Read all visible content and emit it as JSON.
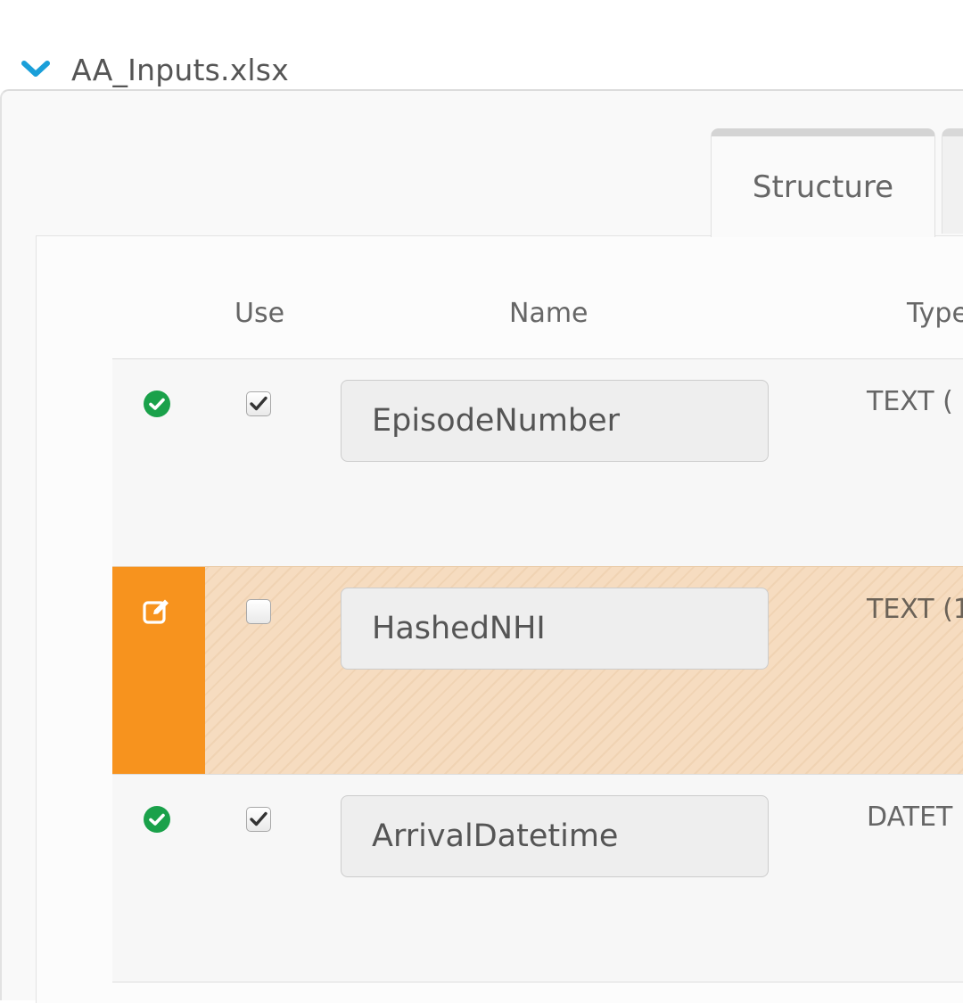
{
  "file": {
    "name": "AA_Inputs.xlsx",
    "expand_icon": "chevron-down-icon",
    "accent_color": "#1a9fd9"
  },
  "tabs": [
    {
      "label": "Structure",
      "active": true
    }
  ],
  "table": {
    "headers": {
      "use": "Use",
      "name": "Name",
      "type": "Type"
    },
    "rows": [
      {
        "status": "ok",
        "status_icon": "check-circle-icon",
        "use": true,
        "name": "EpisodeNumber",
        "type": "TEXT ("
      },
      {
        "status": "changed",
        "status_icon": "edit-icon",
        "use": false,
        "name": "HashedNHI",
        "type": "TEXT (1"
      },
      {
        "status": "ok",
        "status_icon": "check-circle-icon",
        "use": true,
        "name": "ArrivalDatetime",
        "type": "DATET"
      }
    ]
  },
  "colors": {
    "ok": "#1aa14a",
    "changed": "#f7931e",
    "changed_row_bg": "#f6dcc0"
  }
}
